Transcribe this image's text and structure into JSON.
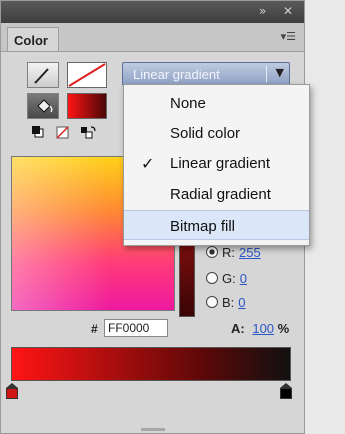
{
  "window": {
    "collapse_icon": "double-chevron",
    "close_icon": "close"
  },
  "panel": {
    "tab_label": "Color",
    "menu_icon": "panel-menu"
  },
  "tools": {
    "stroke_icon": "pencil",
    "stroke_none_icon": "no-color-slash",
    "fill_icon": "paint-bucket",
    "fill_color": "#d01414",
    "black_white_icon": "black-white-swatch",
    "no_color_icon": "no-color",
    "swap_icon": "swap-colors"
  },
  "fill_type": {
    "selected": "Linear gradient",
    "options": [
      "None",
      "Solid color",
      "Linear gradient",
      "Radial gradient",
      "Bitmap fill"
    ],
    "checked": "Linear gradient",
    "hovered": "Bitmap fill"
  },
  "rgb": {
    "r_label": "R:",
    "r_value": "255",
    "g_label": "G:",
    "g_value": "0",
    "b_label": "B:",
    "b_value": "0"
  },
  "hex": {
    "symbol": "#",
    "value": "FF0000"
  },
  "alpha": {
    "label": "A:",
    "value": "100",
    "unit": "%"
  },
  "gradient": {
    "left_stop_color": "#d01414",
    "right_stop_color": "#000000"
  },
  "colors": {
    "selection_highlight": "#dbe7f8",
    "dropdown_blue": "#8da0c4",
    "link_blue": "#2a55c5"
  }
}
